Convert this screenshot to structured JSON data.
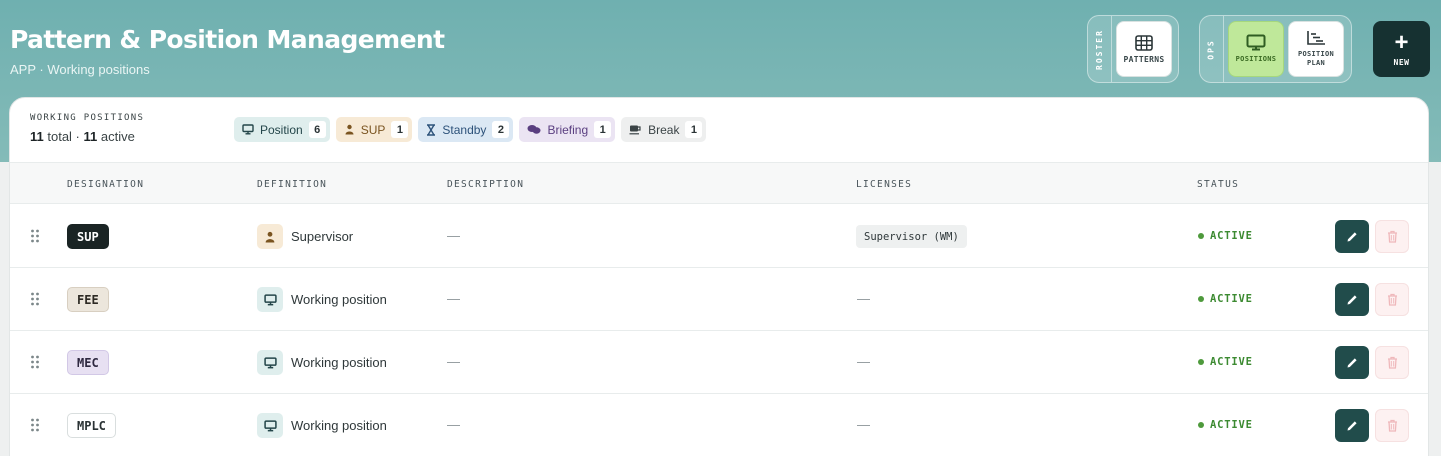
{
  "header": {
    "title": "Pattern & Position Management",
    "breadcrumb": "APP · Working positions"
  },
  "toolbar": {
    "roster_label": "ROSTER",
    "roster_tiles": [
      {
        "label": "PATTERNS",
        "icon": "grid-icon"
      }
    ],
    "ops_label": "OPS",
    "ops_tiles": [
      {
        "label": "POSITIONS",
        "icon": "monitor-icon",
        "active": true
      },
      {
        "label_lines": [
          "POSITION",
          "PLAN"
        ],
        "icon": "chart-icon"
      }
    ],
    "new_label": "NEW"
  },
  "summary": {
    "label": "WORKING POSITIONS",
    "total": "11",
    "total_label": "total ·",
    "active": "11",
    "active_label": "active"
  },
  "chips": [
    {
      "label": "Position",
      "count": "6",
      "icon": "monitor-icon",
      "bg": "#dfeeed",
      "fg": "#24464a"
    },
    {
      "label": "SUP",
      "count": "1",
      "icon": "person-icon",
      "bg": "#f7ead6",
      "fg": "#7a5420"
    },
    {
      "label": "Standby",
      "count": "2",
      "icon": "hourglass-icon",
      "bg": "#dbe8f4",
      "fg": "#2d527a"
    },
    {
      "label": "Briefing",
      "count": "1",
      "icon": "chat-icon",
      "bg": "#ebe4f3",
      "fg": "#5a3e80"
    },
    {
      "label": "Break",
      "count": "1",
      "icon": "coffee-icon",
      "bg": "#eeefef",
      "fg": "#3b4446"
    }
  ],
  "columns": {
    "designation": "DESIGNATION",
    "definition": "DEFINITION",
    "description": "DESCRIPTION",
    "licenses": "LICENSES",
    "status": "STATUS"
  },
  "rows": [
    {
      "code": "SUP",
      "code_style": "dark",
      "definition": "Supervisor",
      "def_icon": "person-icon",
      "description": "—",
      "license": "Supervisor (WM)",
      "status": "ACTIVE"
    },
    {
      "code": "FEE",
      "code_style": "beige",
      "definition": "Working position",
      "def_icon": "monitor-icon",
      "description": "—",
      "license": "—",
      "status": "ACTIVE"
    },
    {
      "code": "MEC",
      "code_style": "lavender",
      "definition": "Working position",
      "def_icon": "monitor-icon",
      "description": "—",
      "license": "—",
      "status": "ACTIVE"
    },
    {
      "code": "MPLC",
      "code_style": "white",
      "definition": "Working position",
      "def_icon": "monitor-icon",
      "description": "—",
      "license": "—",
      "status": "ACTIVE"
    }
  ],
  "colors": {
    "accent": "#214c4b",
    "active_status": "#3c8a31",
    "banner": "#7bb6b4"
  }
}
